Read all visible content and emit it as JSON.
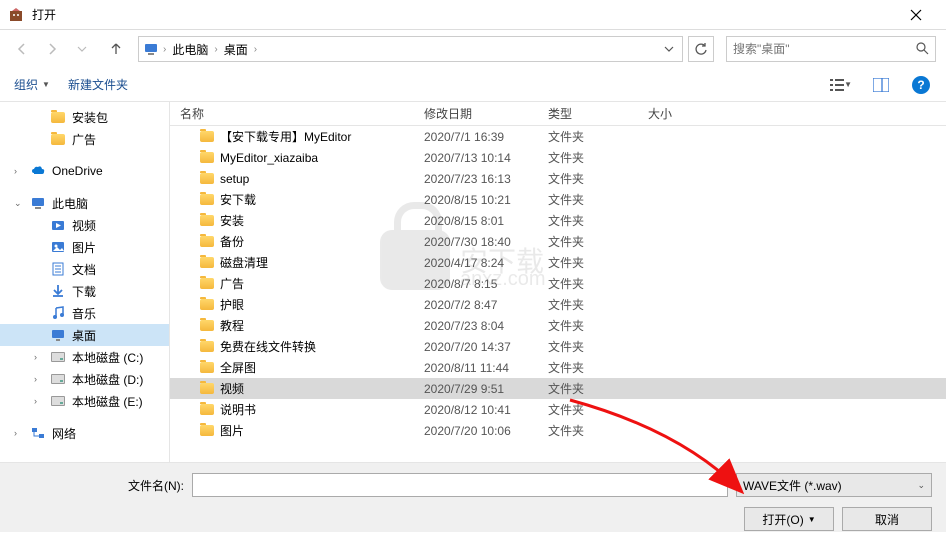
{
  "title": "打开",
  "nav": {
    "breadcrumbs": [
      "此电脑",
      "桌面"
    ],
    "search_placeholder": "搜索\"桌面\""
  },
  "toolbar": {
    "organize": "组织",
    "new_folder": "新建文件夹"
  },
  "sidebar": {
    "items": [
      {
        "label": "安装包",
        "icon": "folder",
        "indent": "sub"
      },
      {
        "label": "广告",
        "icon": "folder",
        "indent": "sub"
      },
      {
        "label": "OneDrive",
        "icon": "onedrive",
        "indent": "top",
        "chev": "›"
      },
      {
        "label": "此电脑",
        "icon": "pc",
        "indent": "top",
        "chev": "⌄"
      },
      {
        "label": "视频",
        "icon": "video",
        "indent": "sub2"
      },
      {
        "label": "图片",
        "icon": "picture",
        "indent": "sub2"
      },
      {
        "label": "文档",
        "icon": "document",
        "indent": "sub2"
      },
      {
        "label": "下载",
        "icon": "download",
        "indent": "sub2"
      },
      {
        "label": "音乐",
        "icon": "music",
        "indent": "sub2"
      },
      {
        "label": "桌面",
        "icon": "desktop",
        "indent": "sub2",
        "selected": true
      },
      {
        "label": "本地磁盘 (C:)",
        "icon": "drive",
        "indent": "sub2",
        "chev": "›"
      },
      {
        "label": "本地磁盘 (D:)",
        "icon": "drive",
        "indent": "sub2",
        "chev": "›"
      },
      {
        "label": "本地磁盘 (E:)",
        "icon": "drive",
        "indent": "sub2",
        "chev": "›"
      },
      {
        "label": "网络",
        "icon": "network",
        "indent": "top",
        "chev": "›"
      }
    ]
  },
  "columns": {
    "name": "名称",
    "date": "修改日期",
    "type": "类型",
    "size": "大小"
  },
  "files": [
    {
      "name": "【安下载专用】MyEditor",
      "date": "2020/7/1 16:39",
      "type": "文件夹"
    },
    {
      "name": "MyEditor_xiazaiba",
      "date": "2020/7/13 10:14",
      "type": "文件夹"
    },
    {
      "name": "setup",
      "date": "2020/7/23 16:13",
      "type": "文件夹"
    },
    {
      "name": "安下载",
      "date": "2020/8/15 10:21",
      "type": "文件夹"
    },
    {
      "name": "安装",
      "date": "2020/8/15 8:01",
      "type": "文件夹"
    },
    {
      "name": "备份",
      "date": "2020/7/30 18:40",
      "type": "文件夹"
    },
    {
      "name": "磁盘清理",
      "date": "2020/4/17 8:24",
      "type": "文件夹"
    },
    {
      "name": "广告",
      "date": "2020/8/7 8:15",
      "type": "文件夹"
    },
    {
      "name": "护眼",
      "date": "2020/7/2 8:47",
      "type": "文件夹"
    },
    {
      "name": "教程",
      "date": "2020/7/23 8:04",
      "type": "文件夹"
    },
    {
      "name": "免费在线文件转换",
      "date": "2020/7/20 14:37",
      "type": "文件夹"
    },
    {
      "name": "全屏图",
      "date": "2020/8/11 11:44",
      "type": "文件夹"
    },
    {
      "name": "视频",
      "date": "2020/7/29 9:51",
      "type": "文件夹",
      "selected": true
    },
    {
      "name": "说明书",
      "date": "2020/8/12 10:41",
      "type": "文件夹"
    },
    {
      "name": "图片",
      "date": "2020/7/20 10:06",
      "type": "文件夹"
    }
  ],
  "footer": {
    "filename_label": "文件名(N):",
    "filename_value": "",
    "filter": "WAVE文件      (*.wav)",
    "open_btn": "打开(O)",
    "cancel_btn": "取消"
  }
}
